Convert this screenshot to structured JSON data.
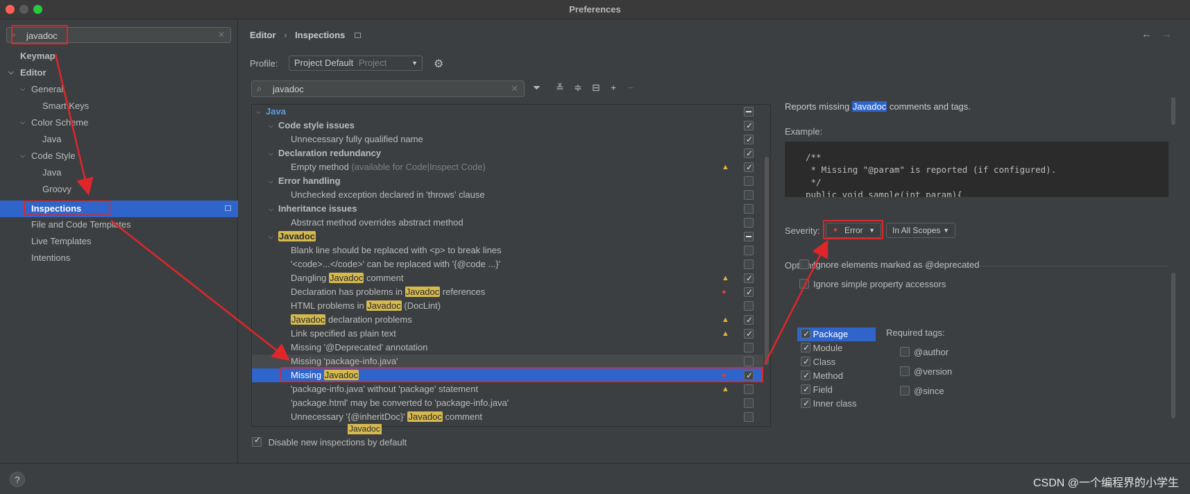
{
  "window": {
    "title": "Preferences"
  },
  "sidebar": {
    "search_value": "javadoc",
    "items": [
      {
        "label": "Keymap"
      },
      {
        "label": "Editor"
      },
      {
        "label": "General"
      },
      {
        "label": "Smart Keys"
      },
      {
        "label": "Color Scheme"
      },
      {
        "label": "Java"
      },
      {
        "label": "Code Style"
      },
      {
        "label": "Java"
      },
      {
        "label": "Groovy"
      },
      {
        "label": "Inspections"
      },
      {
        "label": "File and Code Templates"
      },
      {
        "label": "Live Templates"
      },
      {
        "label": "Intentions"
      }
    ]
  },
  "breadcrumb": {
    "parent": "Editor",
    "separator": "›",
    "current": "Inspections"
  },
  "profile": {
    "label": "Profile:",
    "name": "Project Default",
    "scope": "Project"
  },
  "inspection_search": {
    "value": "javadoc"
  },
  "tree": {
    "java": "Java",
    "code_style": "Code style issues",
    "unnecessary_fqn": "Unnecessary fully qualified name",
    "decl_redundancy": "Declaration redundancy",
    "empty_method": "Empty method",
    "empty_method_note": "(available for Code|Inspect Code)",
    "error_handling": "Error handling",
    "unchecked_exception": "Unchecked exception declared in 'throws' clause",
    "inheritance": "Inheritance issues",
    "abstract_overrides": "Abstract method overrides abstract method",
    "javadoc": "Javadoc",
    "blank_line": "Blank line should be replaced with <p> to break lines",
    "code_replace": "'<code>...</code>' can be replaced with '{@code ...}'",
    "dangling_pre": "Dangling ",
    "dangling_post": " comment",
    "decl_problems_pre": "Declaration has problems in ",
    "decl_problems_post": " references",
    "html_pre": "HTML problems in ",
    "html_post": " (DocLint)",
    "jd_decl_post": " declaration problems",
    "link_plain": "Link specified as plain text",
    "missing_deprecated": "Missing '@Deprecated' annotation",
    "missing_pkg_info": "Missing 'package-info.java'",
    "missing_pre": "Missing ",
    "pkg_info_without": "'package-info.java' without 'package' statement",
    "pkg_html": "'package.html' may be converted to 'package-info.java'",
    "unnecessary_pre": "Unnecessary '{@inheritDoc}' ",
    "unnecessary_post": " comment",
    "tooltip": "Javadoc"
  },
  "disable_new": "Disable new inspections by default",
  "description": {
    "pre": "Reports missing ",
    "highlight": "Javadoc",
    "post": " comments and tags.",
    "example_label": "Example:",
    "code": "/**\n * Missing \"@param\" is reported (if configured).\n */\npublic void sample(int param){"
  },
  "severity": {
    "label": "Severity:",
    "value": "Error",
    "scope": "In All Scopes"
  },
  "options": {
    "label": "Options",
    "ignore_deprecated": "Ignore elements marked as @deprecated",
    "ignore_accessors": "Ignore simple property accessors",
    "kinds": [
      "Package",
      "Module",
      "Class",
      "Method",
      "Field",
      "Inner class"
    ],
    "required_label": "Required tags:",
    "tags": [
      "@author",
      "@version",
      "@since"
    ]
  },
  "footer": {
    "help": "?",
    "watermark": "CSDN @一个编程界的小学生"
  },
  "colors": {
    "selection": "#2f65ca",
    "highlight": "#d6b94f",
    "annotation": "#e0262b",
    "warning": "#e2b53b",
    "error": "#d9413e"
  }
}
